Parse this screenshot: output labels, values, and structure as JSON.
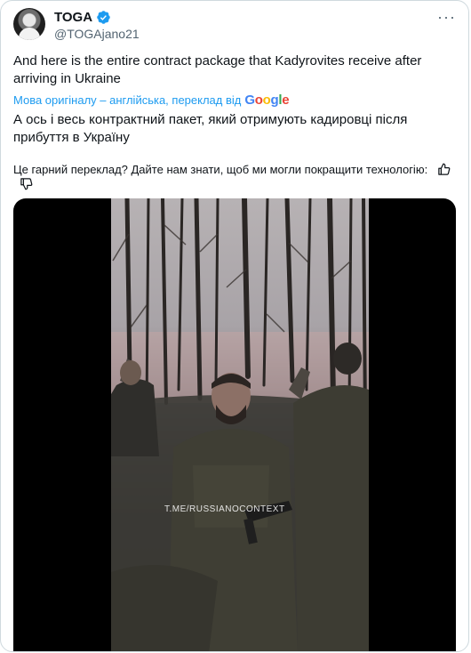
{
  "tweet": {
    "display_name": "TOGA",
    "handle": "@TOGAjano21",
    "text": "And here is the entire contract package that Kadyrovites receive after arriving in Ukraine",
    "translation_note": "Мова оригіналу – англійська, переклад від",
    "translation_provider": "Google",
    "translated_text": "А ось і весь контрактний пакет, який отримують кадировці після прибуття в Україну",
    "feedback_question": "Це гарний переклад? Дайте нам знати, щоб ми могли покращити технологію:",
    "video_watermark": "T.ME/RUSSIANOCONTEXT"
  },
  "colors": {
    "accent": "#1d9bf0",
    "text": "#0f1419",
    "secondary": "#536471",
    "border": "#cfd9de"
  },
  "icons": {
    "verified": "verified-badge-icon",
    "more": "more-options-icon",
    "thumbs_up": "thumbs-up-icon",
    "thumbs_down": "thumbs-down-icon"
  }
}
